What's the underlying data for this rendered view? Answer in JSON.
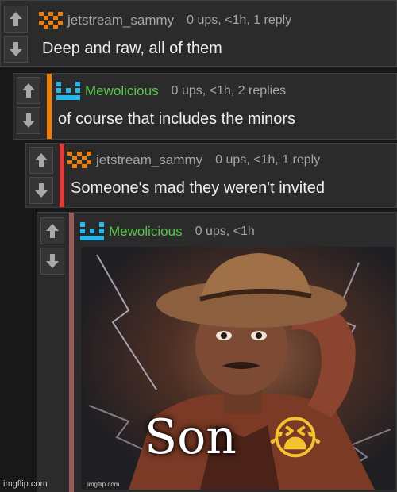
{
  "colors": {
    "background": "#181818",
    "comment_bg": "#2b2b2b",
    "bar_orange": "#f07f0a",
    "bar_red": "#e23b3b",
    "bar_muted": "#9a5a5a",
    "username_green": "#57c64a",
    "username_gray": "#a6a6a6"
  },
  "comments": [
    {
      "username": "jetstream_sammy",
      "meta": "0 ups, <1h, 1 reply",
      "text": "Deep and raw, all of them",
      "user_icon": "orange-face-icon"
    },
    {
      "username": "Mewolicious",
      "meta": "0 ups, <1h, 2 replies",
      "text": "of course that includes the minors",
      "user_icon": "blue-face-icon"
    },
    {
      "username": "jetstream_sammy",
      "meta": "0 ups, <1h, 1 reply",
      "text": "Someone's mad they weren't invited",
      "user_icon": "orange-face-icon"
    },
    {
      "username": "Mewolicious",
      "meta": "0 ups, <1h",
      "user_icon": "blue-face-icon"
    }
  ],
  "meme": {
    "caption": "Son",
    "emoji": "😭",
    "small_mark": "imgflip.com"
  },
  "watermark": "imgflip.com"
}
